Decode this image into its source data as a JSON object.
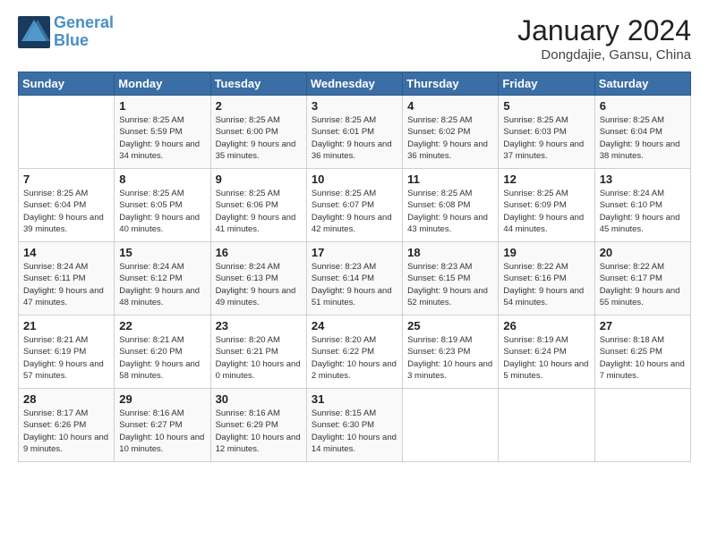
{
  "header": {
    "logo_line1": "General",
    "logo_line2": "Blue",
    "month_title": "January 2024",
    "location": "Dongdajie, Gansu, China"
  },
  "weekdays": [
    "Sunday",
    "Monday",
    "Tuesday",
    "Wednesday",
    "Thursday",
    "Friday",
    "Saturday"
  ],
  "weeks": [
    [
      {
        "day": "",
        "sunrise": "",
        "sunset": "",
        "daylight": ""
      },
      {
        "day": "1",
        "sunrise": "Sunrise: 8:25 AM",
        "sunset": "Sunset: 5:59 PM",
        "daylight": "Daylight: 9 hours and 34 minutes."
      },
      {
        "day": "2",
        "sunrise": "Sunrise: 8:25 AM",
        "sunset": "Sunset: 6:00 PM",
        "daylight": "Daylight: 9 hours and 35 minutes."
      },
      {
        "day": "3",
        "sunrise": "Sunrise: 8:25 AM",
        "sunset": "Sunset: 6:01 PM",
        "daylight": "Daylight: 9 hours and 36 minutes."
      },
      {
        "day": "4",
        "sunrise": "Sunrise: 8:25 AM",
        "sunset": "Sunset: 6:02 PM",
        "daylight": "Daylight: 9 hours and 36 minutes."
      },
      {
        "day": "5",
        "sunrise": "Sunrise: 8:25 AM",
        "sunset": "Sunset: 6:03 PM",
        "daylight": "Daylight: 9 hours and 37 minutes."
      },
      {
        "day": "6",
        "sunrise": "Sunrise: 8:25 AM",
        "sunset": "Sunset: 6:04 PM",
        "daylight": "Daylight: 9 hours and 38 minutes."
      }
    ],
    [
      {
        "day": "7",
        "sunrise": "Sunrise: 8:25 AM",
        "sunset": "Sunset: 6:04 PM",
        "daylight": "Daylight: 9 hours and 39 minutes."
      },
      {
        "day": "8",
        "sunrise": "Sunrise: 8:25 AM",
        "sunset": "Sunset: 6:05 PM",
        "daylight": "Daylight: 9 hours and 40 minutes."
      },
      {
        "day": "9",
        "sunrise": "Sunrise: 8:25 AM",
        "sunset": "Sunset: 6:06 PM",
        "daylight": "Daylight: 9 hours and 41 minutes."
      },
      {
        "day": "10",
        "sunrise": "Sunrise: 8:25 AM",
        "sunset": "Sunset: 6:07 PM",
        "daylight": "Daylight: 9 hours and 42 minutes."
      },
      {
        "day": "11",
        "sunrise": "Sunrise: 8:25 AM",
        "sunset": "Sunset: 6:08 PM",
        "daylight": "Daylight: 9 hours and 43 minutes."
      },
      {
        "day": "12",
        "sunrise": "Sunrise: 8:25 AM",
        "sunset": "Sunset: 6:09 PM",
        "daylight": "Daylight: 9 hours and 44 minutes."
      },
      {
        "day": "13",
        "sunrise": "Sunrise: 8:24 AM",
        "sunset": "Sunset: 6:10 PM",
        "daylight": "Daylight: 9 hours and 45 minutes."
      }
    ],
    [
      {
        "day": "14",
        "sunrise": "Sunrise: 8:24 AM",
        "sunset": "Sunset: 6:11 PM",
        "daylight": "Daylight: 9 hours and 47 minutes."
      },
      {
        "day": "15",
        "sunrise": "Sunrise: 8:24 AM",
        "sunset": "Sunset: 6:12 PM",
        "daylight": "Daylight: 9 hours and 48 minutes."
      },
      {
        "day": "16",
        "sunrise": "Sunrise: 8:24 AM",
        "sunset": "Sunset: 6:13 PM",
        "daylight": "Daylight: 9 hours and 49 minutes."
      },
      {
        "day": "17",
        "sunrise": "Sunrise: 8:23 AM",
        "sunset": "Sunset: 6:14 PM",
        "daylight": "Daylight: 9 hours and 51 minutes."
      },
      {
        "day": "18",
        "sunrise": "Sunrise: 8:23 AM",
        "sunset": "Sunset: 6:15 PM",
        "daylight": "Daylight: 9 hours and 52 minutes."
      },
      {
        "day": "19",
        "sunrise": "Sunrise: 8:22 AM",
        "sunset": "Sunset: 6:16 PM",
        "daylight": "Daylight: 9 hours and 54 minutes."
      },
      {
        "day": "20",
        "sunrise": "Sunrise: 8:22 AM",
        "sunset": "Sunset: 6:17 PM",
        "daylight": "Daylight: 9 hours and 55 minutes."
      }
    ],
    [
      {
        "day": "21",
        "sunrise": "Sunrise: 8:21 AM",
        "sunset": "Sunset: 6:19 PM",
        "daylight": "Daylight: 9 hours and 57 minutes."
      },
      {
        "day": "22",
        "sunrise": "Sunrise: 8:21 AM",
        "sunset": "Sunset: 6:20 PM",
        "daylight": "Daylight: 9 hours and 58 minutes."
      },
      {
        "day": "23",
        "sunrise": "Sunrise: 8:20 AM",
        "sunset": "Sunset: 6:21 PM",
        "daylight": "Daylight: 10 hours and 0 minutes."
      },
      {
        "day": "24",
        "sunrise": "Sunrise: 8:20 AM",
        "sunset": "Sunset: 6:22 PM",
        "daylight": "Daylight: 10 hours and 2 minutes."
      },
      {
        "day": "25",
        "sunrise": "Sunrise: 8:19 AM",
        "sunset": "Sunset: 6:23 PM",
        "daylight": "Daylight: 10 hours and 3 minutes."
      },
      {
        "day": "26",
        "sunrise": "Sunrise: 8:19 AM",
        "sunset": "Sunset: 6:24 PM",
        "daylight": "Daylight: 10 hours and 5 minutes."
      },
      {
        "day": "27",
        "sunrise": "Sunrise: 8:18 AM",
        "sunset": "Sunset: 6:25 PM",
        "daylight": "Daylight: 10 hours and 7 minutes."
      }
    ],
    [
      {
        "day": "28",
        "sunrise": "Sunrise: 8:17 AM",
        "sunset": "Sunset: 6:26 PM",
        "daylight": "Daylight: 10 hours and 9 minutes."
      },
      {
        "day": "29",
        "sunrise": "Sunrise: 8:16 AM",
        "sunset": "Sunset: 6:27 PM",
        "daylight": "Daylight: 10 hours and 10 minutes."
      },
      {
        "day": "30",
        "sunrise": "Sunrise: 8:16 AM",
        "sunset": "Sunset: 6:29 PM",
        "daylight": "Daylight: 10 hours and 12 minutes."
      },
      {
        "day": "31",
        "sunrise": "Sunrise: 8:15 AM",
        "sunset": "Sunset: 6:30 PM",
        "daylight": "Daylight: 10 hours and 14 minutes."
      },
      {
        "day": "",
        "sunrise": "",
        "sunset": "",
        "daylight": ""
      },
      {
        "day": "",
        "sunrise": "",
        "sunset": "",
        "daylight": ""
      },
      {
        "day": "",
        "sunrise": "",
        "sunset": "",
        "daylight": ""
      }
    ]
  ]
}
